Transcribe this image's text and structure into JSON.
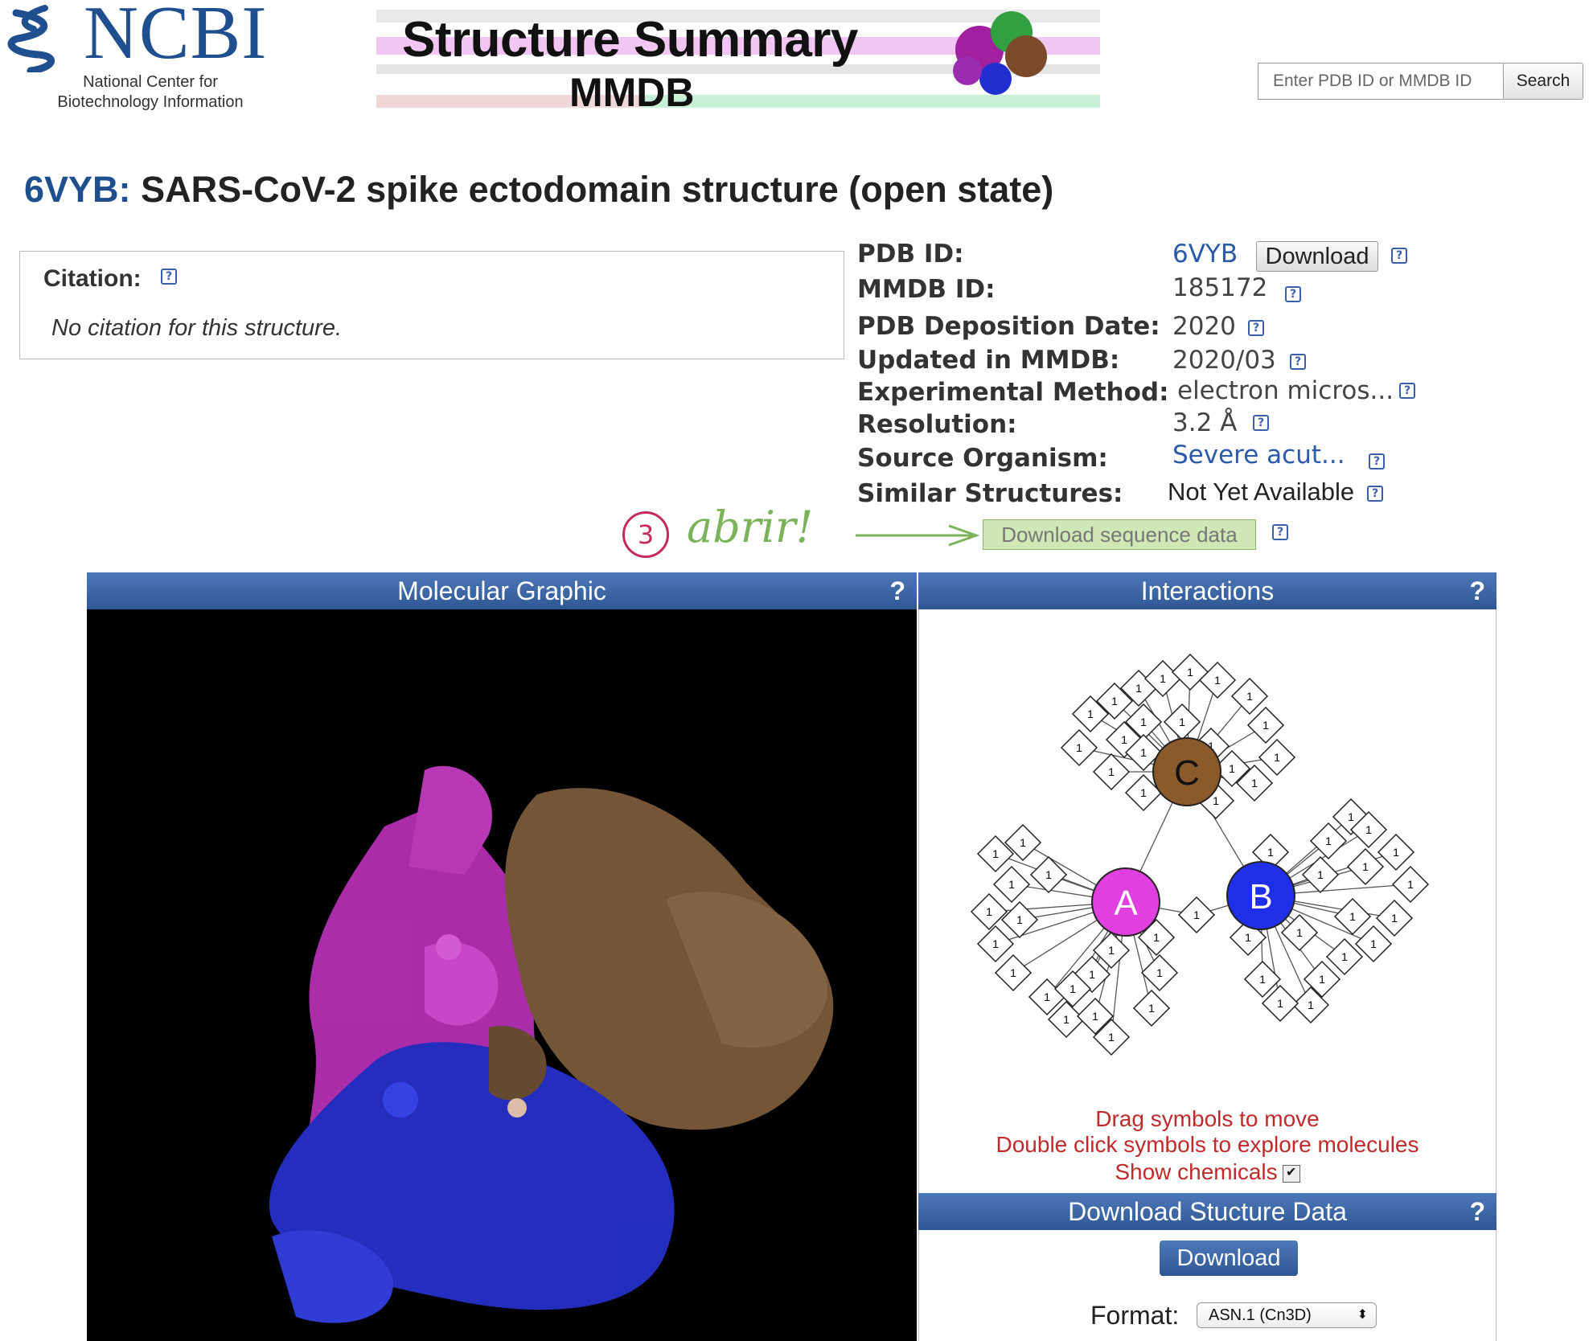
{
  "header": {
    "logo_text": "NCBI",
    "logo_subtitle_line1": "National Center for",
    "logo_subtitle_line2": "Biotechnology Information",
    "banner_title": "Structure Summary",
    "banner_subtitle": "MMDB",
    "search_placeholder": "Enter PDB ID or MMDB ID",
    "search_button": "Search"
  },
  "title": {
    "pdb_id": "6VYB:",
    "name": "SARS-CoV-2 spike ectodomain structure (open state)"
  },
  "citation": {
    "label": "Citation:",
    "text": "No citation for this structure."
  },
  "info": {
    "pdb_id_label": "PDB ID:",
    "pdb_id_value": "6VYB",
    "pdb_download": "Download",
    "mmdb_id_label": "MMDB ID:",
    "mmdb_id_value": "185172",
    "deposition_label": "PDB Deposition Date:",
    "deposition_value": "2020",
    "updated_label": "Updated in MMDB:",
    "updated_value": "2020/03",
    "method_label": "Experimental Method:",
    "method_value": "electron micros...",
    "resolution_label": "Resolution:",
    "resolution_value": "3.2  Å",
    "organism_label": "Source Organism:",
    "organism_value": "Severe acut...",
    "similar_label": "Similar Structures:",
    "similar_value": "Not Yet Available",
    "seq_download": "Download sequence data"
  },
  "annotation": {
    "number": "3",
    "text": "abrir!",
    "color": "#7bb35a"
  },
  "molecular_panel": {
    "title": "Molecular Graphic",
    "help": "?"
  },
  "interactions_panel": {
    "title": "Interactions",
    "help": "?",
    "chains": [
      {
        "label": "C",
        "color": "#8a5a2b"
      },
      {
        "label": "A",
        "color": "#e040e0"
      },
      {
        "label": "B",
        "color": "#1f2fe8"
      }
    ],
    "ligand_label": "1",
    "hint1": "Drag symbols to move",
    "hint2": "Double click symbols to explore molecules",
    "hint3": "Show chemicals",
    "show_chemicals_checked": "✔"
  },
  "download_panel": {
    "title": "Download Stucture Data",
    "help": "?",
    "button": "Download",
    "format_label": "Format:",
    "format_value": "ASN.1 (Cn3D)",
    "format_arrows": "⬍"
  }
}
